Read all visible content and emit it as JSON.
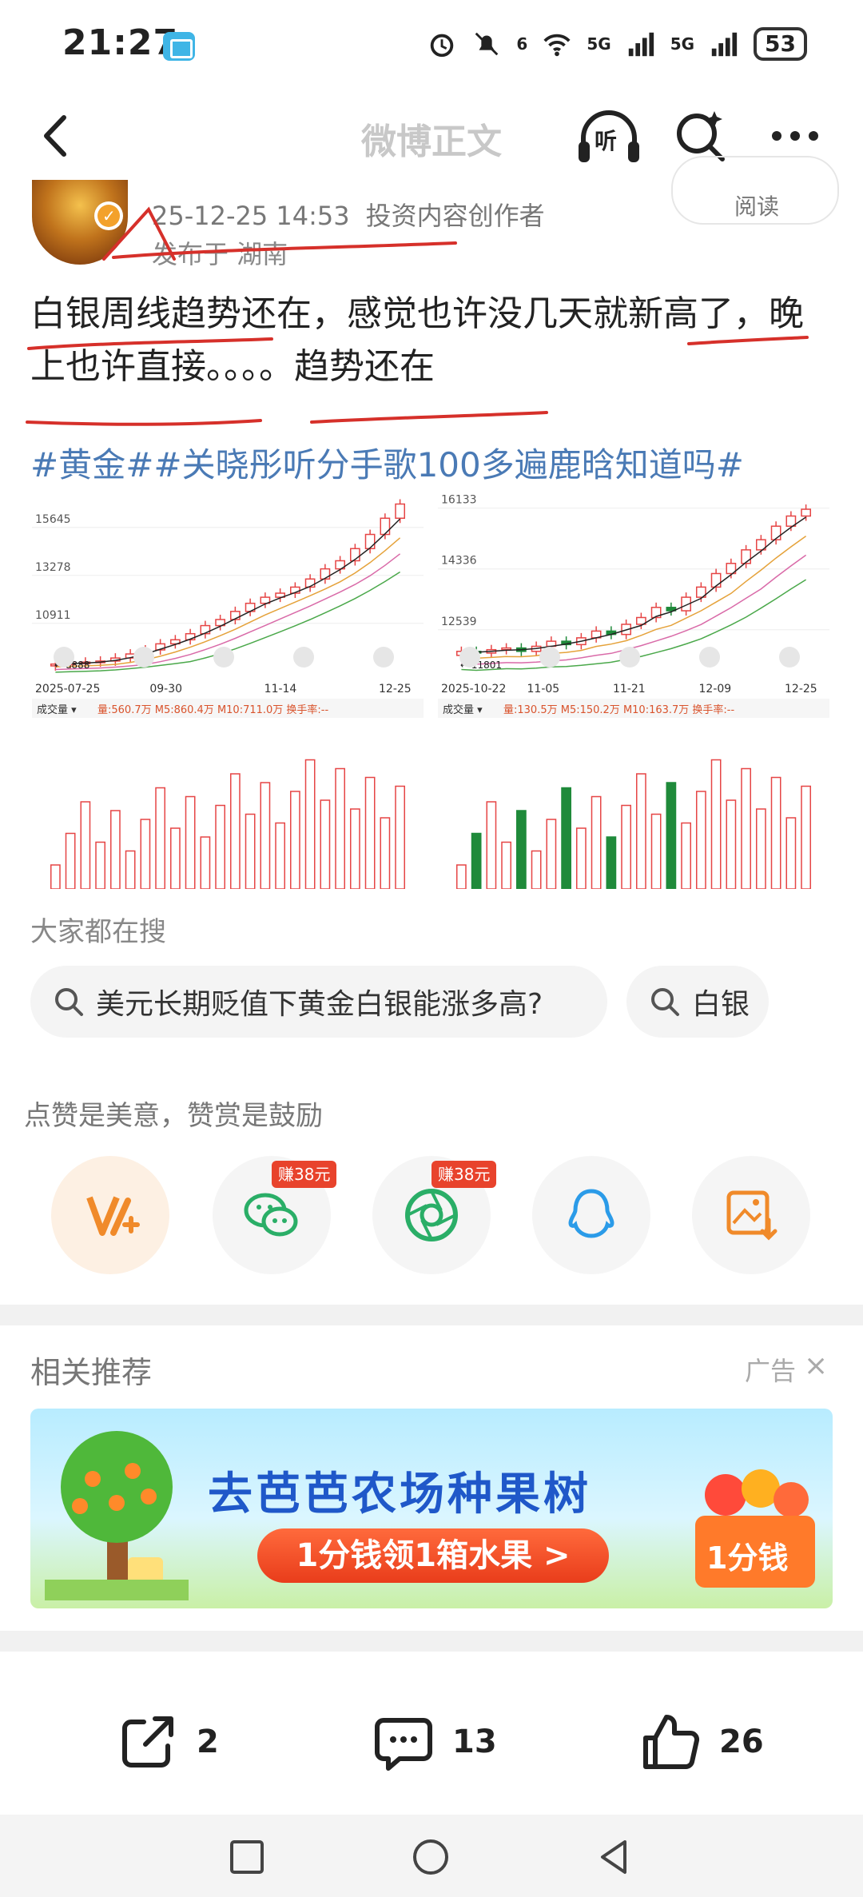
{
  "status_bar": {
    "time": "21:27",
    "signal_1": "6",
    "signal_2": "5G",
    "signal_3": "5G",
    "battery": "53"
  },
  "nav": {
    "title": "微博正文",
    "listen_label": "听"
  },
  "author": {
    "timestamp": "25-12-25 14:53",
    "role": "投资内容创作者",
    "location": "发布于 湖南",
    "read_label": "阅读"
  },
  "post": {
    "text": "白银周线趋势还在，感觉也许没几天就新高了，晚上也许直接。。。。趋势还在",
    "hashtags": "#黄金##关晓彤听分手歌100多遍鹿晗知道吗#"
  },
  "chart_data": [
    {
      "type": "candlestick",
      "y_ticks": [
        "15645",
        "13278",
        "10911"
      ],
      "x_labels": [
        "2025-07-25",
        "09-30",
        "11-14",
        "12-25"
      ],
      "low_marker": "8888",
      "volume_label": "成交量",
      "volume_stats": "量:560.7万  M5:860.4万  M10:711.0万  换手率:--",
      "closes": [
        8900,
        8950,
        9000,
        9050,
        9200,
        9400,
        9600,
        9900,
        10100,
        10400,
        10800,
        11100,
        11500,
        11900,
        12200,
        12400,
        12700,
        13100,
        13600,
        14000,
        14600,
        15300,
        16100,
        16800
      ]
    },
    {
      "type": "candlestick",
      "y_ticks": [
        "16133",
        "14336",
        "12539"
      ],
      "x_labels": [
        "2025-10-22",
        "11-05",
        "11-21",
        "12-09",
        "12-25"
      ],
      "low_marker": "11801",
      "volume_label": "成交量",
      "volume_stats": "量:130.5万  M5:150.2万  M10:163.7万  换手率:--",
      "closes": [
        11900,
        11850,
        11950,
        12000,
        11900,
        12050,
        12200,
        12100,
        12300,
        12500,
        12400,
        12700,
        12900,
        13200,
        13100,
        13500,
        13800,
        14200,
        14500,
        14900,
        15200,
        15600,
        15900,
        16100
      ]
    }
  ],
  "search_section": {
    "title": "大家都在搜",
    "pills": [
      "美元长期贬值下黄金白银能涨多高?",
      "白银"
    ]
  },
  "reward": {
    "hint": "点赞是美意，赞赏是鼓励",
    "earn_badge_1": "赚38元",
    "earn_badge_2": "赚38元"
  },
  "recommend": {
    "title": "相关推荐",
    "ad_tag": "广告",
    "ad_close": "×",
    "ad_title": "去芭芭农场种果树",
    "ad_button": "1分钱领1箱水果 >",
    "ad_box_label": "1分钱"
  },
  "bottom_bar": {
    "share_count": "2",
    "comment_count": "13",
    "like_count": "26"
  },
  "colors": {
    "accent_blue": "#4a7ab5",
    "reward_badge": "#e8432c",
    "ad_blue": "#1f58c9",
    "candle_up": "#e64545",
    "candle_down": "#1f8a3a"
  }
}
